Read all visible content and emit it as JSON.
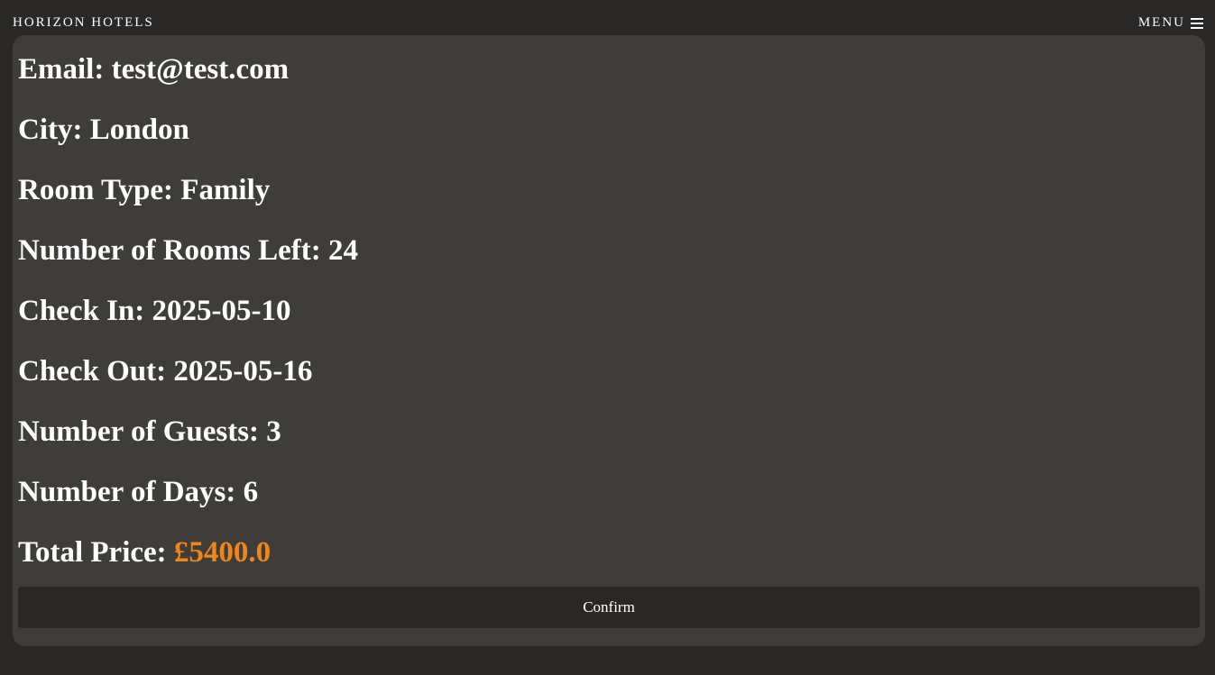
{
  "header": {
    "brand": "HORIZON HOTELS",
    "menu_label": "MENU",
    "menu_icon": "hamburger-icon"
  },
  "details": [
    {
      "label": "Email:",
      "value": "test@test.com"
    },
    {
      "label": "City:",
      "value": "London"
    },
    {
      "label": "Room Type:",
      "value": "Family"
    },
    {
      "label": "Number of Rooms Left:",
      "value": "24"
    },
    {
      "label": "Check In:",
      "value": "2025-05-10"
    },
    {
      "label": "Check Out:",
      "value": "2025-05-16"
    },
    {
      "label": "Number of Guests:",
      "value": "3"
    },
    {
      "label": "Number of Days:",
      "value": "6"
    }
  ],
  "total": {
    "label": "Total Price:",
    "value": "£5400.0",
    "color": "#f0861a"
  },
  "confirm_label": "Confirm"
}
